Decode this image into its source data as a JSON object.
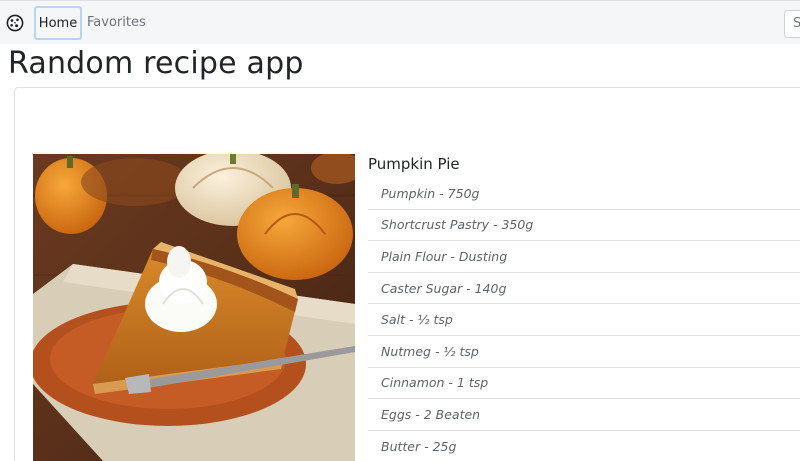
{
  "nav": {
    "home_label": "Home",
    "favorites_label": "Favorites",
    "search_placeholder": "Search"
  },
  "page": {
    "title": "Random recipe app"
  },
  "recipe": {
    "name": "Pumpkin Pie",
    "image_icon": "pumpkin-pie-photo",
    "ingredients": [
      "Pumpkin - 750g",
      "Shortcrust Pastry - 350g",
      "Plain Flour - Dusting",
      "Caster Sugar - 140g",
      "Salt - ½ tsp",
      "Nutmeg - ½ tsp",
      "Cinnamon - 1 tsp",
      "Eggs - 2 Beaten",
      "Butter - 25g"
    ]
  },
  "colors": {
    "nav_bg": "#f5f6f8",
    "focus_ring": "#b9d3f0"
  }
}
